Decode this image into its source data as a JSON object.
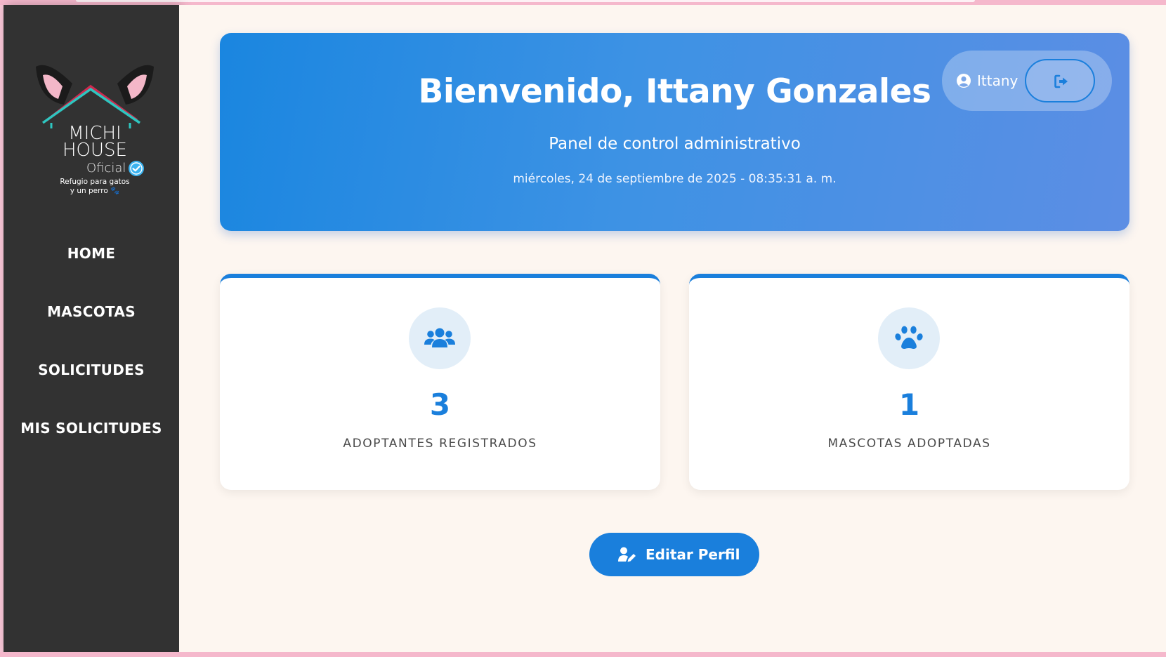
{
  "sidebar": {
    "logo": {
      "line1": "MICHI",
      "line2": "HOUSE",
      "oficial": "Oficial",
      "tagline1": "Refugio para gatos",
      "tagline2": "y un perro 🐾"
    },
    "items": [
      {
        "label": "HOME"
      },
      {
        "label": "MASCOTAS"
      },
      {
        "label": "SOLICITUDES"
      },
      {
        "label": "MIS SOLICITUDES"
      }
    ]
  },
  "hero": {
    "title": "Bienvenido, Ittany Gonzales",
    "subtitle": "Panel de control administrativo",
    "datetime": "miércoles, 24 de septiembre de 2025 - 08:35:31 a. m.",
    "user": {
      "name": "Ittany",
      "icon": "user-circle-icon",
      "logout_icon": "sign-out-icon"
    }
  },
  "stats": [
    {
      "value": "3",
      "label": "ADOPTANTES REGISTRADOS",
      "icon": "users-icon"
    },
    {
      "value": "1",
      "label": "MASCOTAS ADOPTADAS",
      "icon": "paw-icon"
    }
  ],
  "actions": {
    "edit_profile": {
      "label": "Editar Perfil",
      "icon": "user-edit-icon"
    }
  },
  "colors": {
    "accent": "#1a7fdc",
    "sidebar": "#323232",
    "background": "#fdf6f0",
    "frame": "#f7c6d6"
  }
}
